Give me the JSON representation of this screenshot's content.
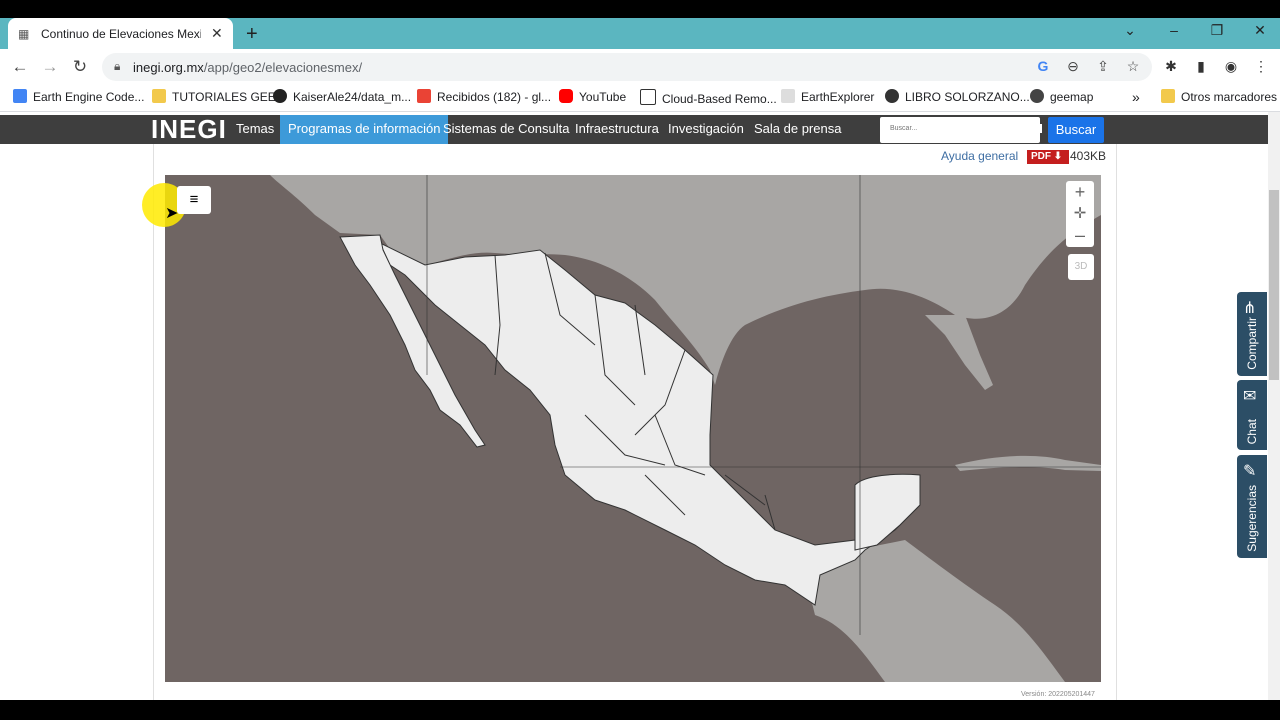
{
  "browser": {
    "tab_title": "Continuo de Elevaciones Mexicano",
    "tab_close": "✕",
    "new_tab": "+",
    "url_host": "inegi.org.mx",
    "url_path": "/app/geo2/elevacionesmex/",
    "window_controls": {
      "tab_search": "⌄",
      "minimize": "–",
      "restore": "❐",
      "close": "✕"
    },
    "bookmarks": [
      {
        "label": "Earth Engine Code...",
        "color": "#4285f4"
      },
      {
        "label": "TUTORIALES GEE",
        "color": "#f2c94c"
      },
      {
        "label": "KaiserAle24/data_m...",
        "color": "#222222"
      },
      {
        "label": "Recibidos (182) - gl...",
        "color": "#ea4335"
      },
      {
        "label": "YouTube",
        "color": "#ff0000"
      },
      {
        "label": "Cloud-Based Remo...",
        "color": "#333333"
      },
      {
        "label": "EarthExplorer",
        "color": "#555555"
      },
      {
        "label": "LIBRO SOLORZANO...",
        "color": "#333333"
      },
      {
        "label": "geemap",
        "color": "#444444"
      }
    ],
    "bookmarks_overflow": "»",
    "other_bookmarks": "Otros marcadores"
  },
  "site": {
    "logo": "INEGI",
    "menu": [
      {
        "label": "Temas",
        "active": false
      },
      {
        "label": "Programas de información",
        "active": true
      },
      {
        "label": "Sistemas de Consulta",
        "active": false
      },
      {
        "label": "Infraestructura",
        "active": false
      },
      {
        "label": "Investigación",
        "active": false
      },
      {
        "label": "Sala de prensa",
        "active": false
      }
    ],
    "search_placeholder": "Buscar...",
    "search_button": "Buscar",
    "help_link": "Ayuda general",
    "pdf_label": "PDF",
    "pdf_size": "403KB"
  },
  "map": {
    "menu_icon": "≡",
    "zoom_in": "+",
    "zoom_extent": "✛",
    "zoom_out": "–",
    "btn_3d": "3D",
    "version": "Versión: 202205201447",
    "land_color": "#ededed",
    "water_color": "#6f6563",
    "neighbor_color": "#a8a6a4"
  },
  "side_tabs": [
    {
      "label": "Compartir",
      "icon": "share-icon"
    },
    {
      "label": "Chat",
      "icon": "chat-icon"
    },
    {
      "label": "Sugerencias",
      "icon": "edit-icon"
    }
  ]
}
